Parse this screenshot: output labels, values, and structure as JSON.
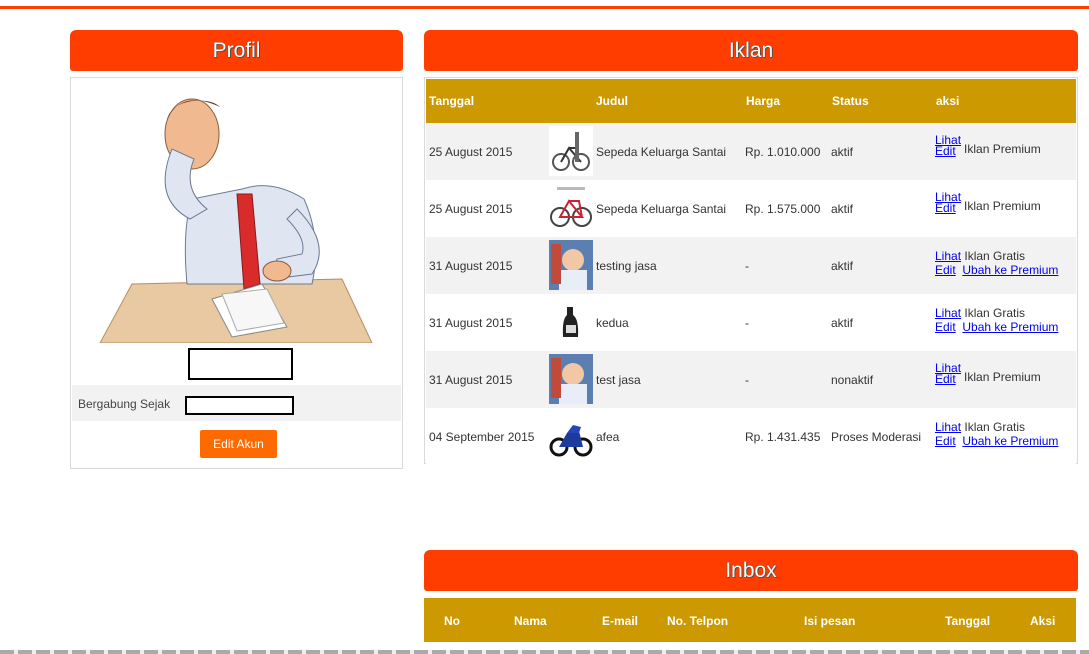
{
  "profil": {
    "title": "Profil",
    "avatar_alt": "avatar",
    "bergabung_label": "Bergabung Sejak",
    "edit_button": "Edit Akun"
  },
  "iklan": {
    "title": "Iklan",
    "columns": [
      "Tanggal",
      "Judul",
      "Harga",
      "Status",
      "aksi"
    ],
    "rows": [
      {
        "tanggal": "25 August 2015",
        "judul": "Sepeda Keluarga Santai",
        "harga": "Rp. 1.010.000",
        "status": "aktif",
        "thumb": "bike-rack-icon",
        "lihat": "Lihat",
        "edit": "Edit",
        "jenis": "Iklan Premium",
        "ubah": ""
      },
      {
        "tanggal": "25 August 2015",
        "judul": "Sepeda Keluarga Santai",
        "harga": "Rp. 1.575.000",
        "status": "aktif",
        "thumb": "bicycle-icon",
        "lihat": "Lihat",
        "edit": "Edit",
        "jenis": "Iklan Premium",
        "ubah": ""
      },
      {
        "tanggal": "31 August 2015",
        "judul": "testing jasa",
        "harga": "-",
        "status": "aktif",
        "thumb": "child-photo-icon",
        "lihat": "Lihat",
        "edit": "Edit",
        "jenis": "Iklan Gratis",
        "ubah": "Ubah ke Premium"
      },
      {
        "tanggal": "31 August 2015",
        "judul": "kedua",
        "harga": "-",
        "status": "aktif",
        "thumb": "bottle-icon",
        "lihat": "Lihat",
        "edit": "Edit",
        "jenis": "Iklan Gratis",
        "ubah": "Ubah ke Premium"
      },
      {
        "tanggal": "31 August 2015",
        "judul": "test jasa",
        "harga": "-",
        "status": "nonaktif",
        "thumb": "child-photo-icon",
        "lihat": "Lihat",
        "edit": "Edit",
        "jenis": "Iklan Premium",
        "ubah": ""
      },
      {
        "tanggal": "04 September 2015",
        "judul": "afea",
        "harga": "Rp. 1.431.435",
        "status": "Proses Moderasi",
        "thumb": "motorcycle-icon",
        "lihat": "Lihat",
        "edit": "Edit",
        "jenis": "Iklan Gratis",
        "ubah": "Ubah ke Premium"
      }
    ]
  },
  "inbox": {
    "title": "Inbox",
    "columns": [
      "No",
      "Nama",
      "E-mail",
      "No. Telpon",
      "Isi pesan",
      "Tanggal",
      "Aksi"
    ]
  },
  "colors": {
    "accent": "#ff3d00",
    "header_bar": "#cc9900",
    "button": "#ff6a00",
    "link": "#0000ee"
  }
}
